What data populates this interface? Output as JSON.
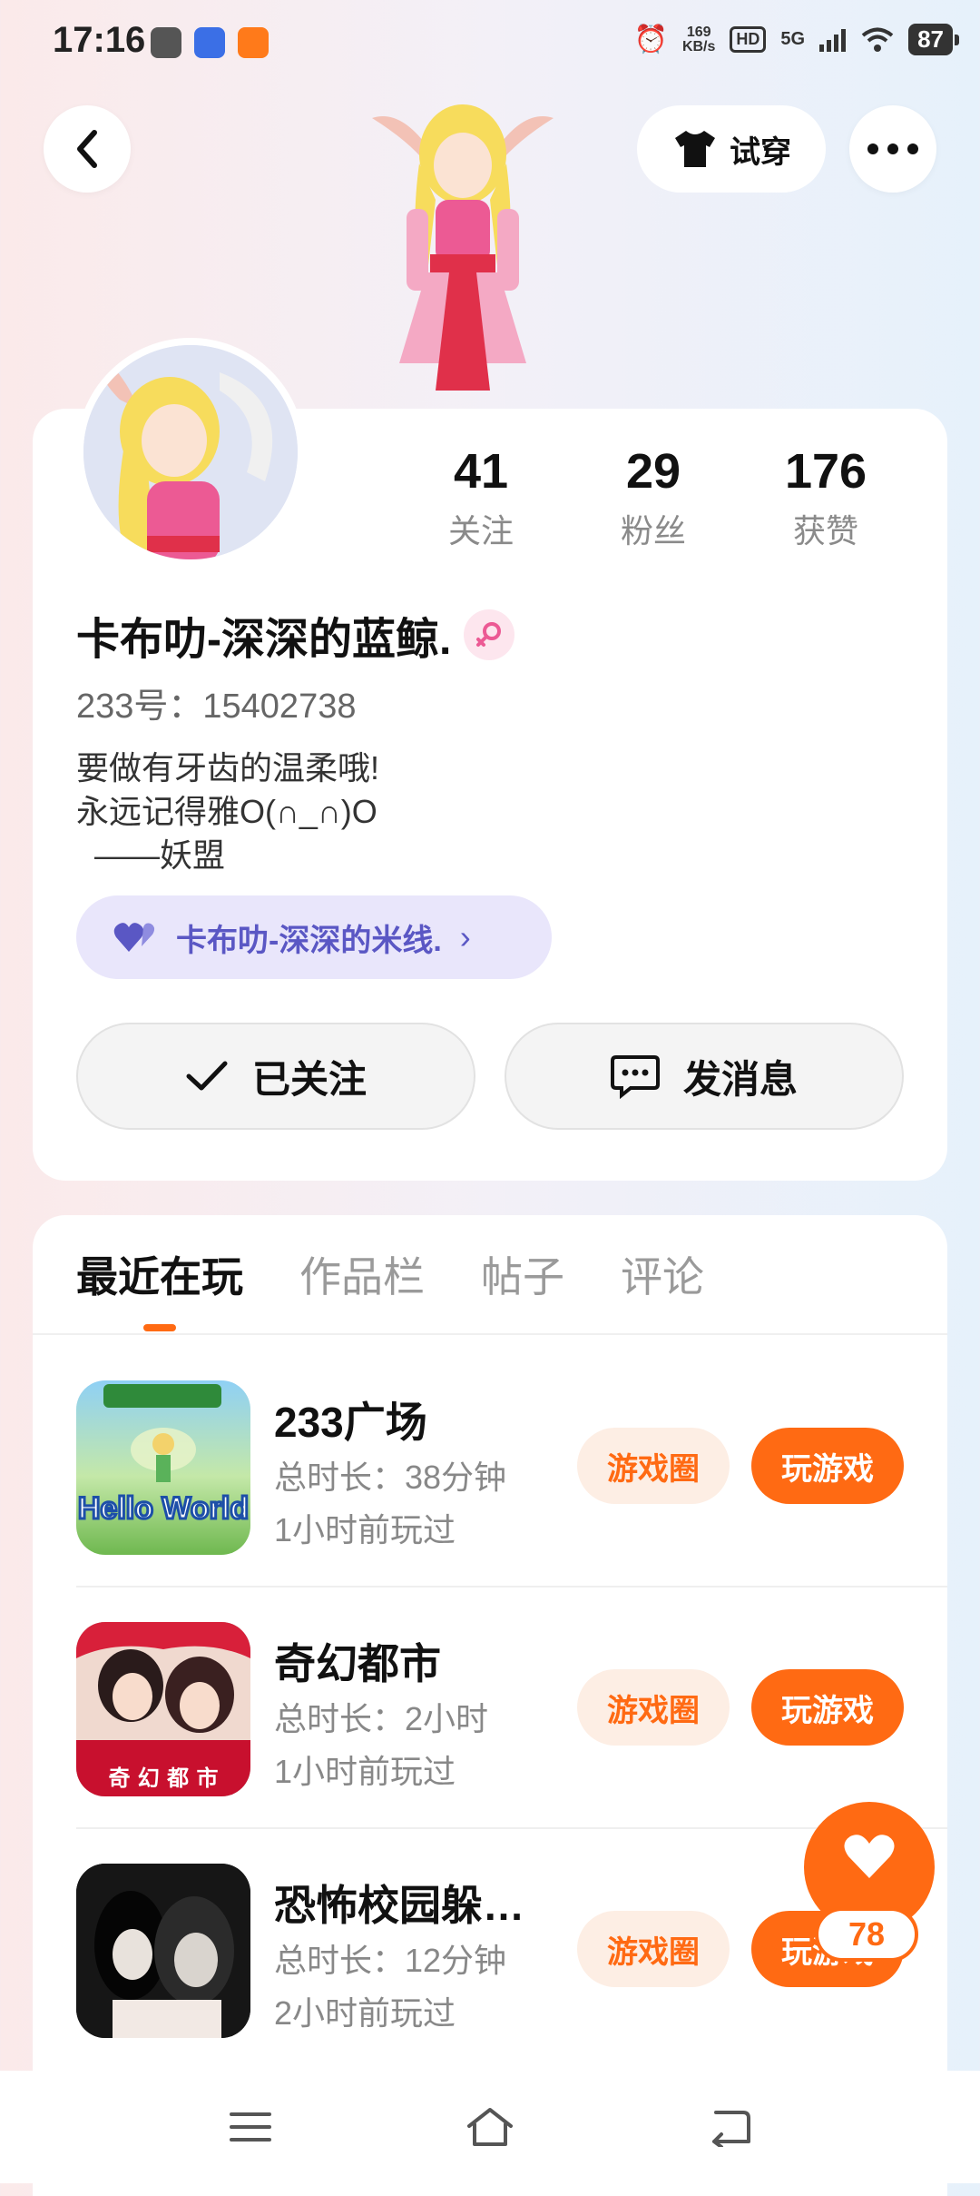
{
  "status_bar": {
    "time": "17:16",
    "net_speed": "169",
    "net_unit": "KB/s",
    "hd": "HD",
    "network": "5G",
    "battery": "87"
  },
  "header": {
    "try_on_label": "试穿"
  },
  "profile": {
    "stats": [
      {
        "num": "41",
        "label": "关注"
      },
      {
        "num": "29",
        "label": "粉丝"
      },
      {
        "num": "176",
        "label": "获赞"
      }
    ],
    "username": "卡布叻-深深的蓝鲸.",
    "uid": "233号：15402738",
    "bio": "要做有牙齿的温柔哦!\n永远记得雅O(∩_∩)O\n  ——妖盟",
    "cp_name": "卡布叻-深深的米线.",
    "follow_label": "已关注",
    "message_label": "发消息"
  },
  "tabs": [
    "最近在玩",
    "作品栏",
    "帖子",
    "评论"
  ],
  "games": [
    {
      "name": "233广场",
      "duration": "总时长：38分钟",
      "last_played": "1小时前玩过",
      "thumb_text": "Hello World"
    },
    {
      "name": "奇幻都市",
      "duration": "总时长：2小时",
      "last_played": "1小时前玩过",
      "thumb_text": "奇 幻 都 市"
    },
    {
      "name": "恐怖校园躲…",
      "duration": "总时长：12分钟",
      "last_played": "2小时前玩过",
      "thumb_text": ""
    }
  ],
  "game_actions": {
    "circle": "游戏圈",
    "play": "玩游戏"
  },
  "like_count": "78",
  "colors": {
    "accent": "#ff6a13",
    "cp_text": "#5a57c4"
  }
}
